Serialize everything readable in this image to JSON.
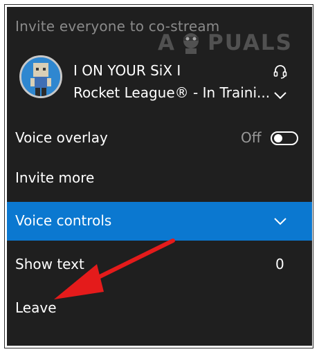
{
  "header": {
    "text": "Invite everyone to co-stream"
  },
  "watermark": {
    "text_left": "A",
    "text_right": "PUALS"
  },
  "user": {
    "name": "I ON YOUR SiX I",
    "status": "Rocket League® - In Traini..."
  },
  "menu": {
    "voice_overlay": {
      "label": "Voice overlay",
      "state": "Off"
    },
    "invite_more": {
      "label": "Invite more"
    },
    "voice_controls": {
      "label": "Voice controls"
    },
    "show_text": {
      "label": "Show text",
      "count": "0"
    },
    "leave": {
      "label": "Leave"
    }
  },
  "colors": {
    "panel_bg": "#1f1f1f",
    "selected_bg": "#0b78d0",
    "annotation_arrow": "#e41b1b"
  },
  "icons": [
    "headset-icon",
    "chevron-down-icon",
    "toggle-switch",
    "annotation-arrow"
  ]
}
